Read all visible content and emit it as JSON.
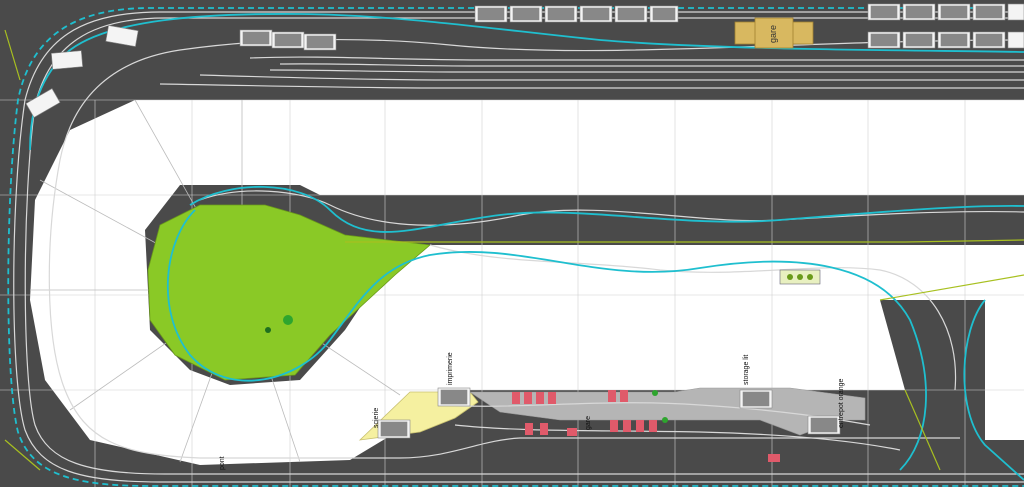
{
  "labels": {
    "gare": "gare",
    "imprimerie": "imprimerie",
    "scierie": "scierie",
    "storage": "storage lit",
    "entrepot": "entrepot orange",
    "pont": "pont",
    "gare_small": "gare"
  },
  "colors": {
    "board": "#4a4a4a",
    "cyan_track": "#1fbfcf",
    "white_track": "#d8d8d8",
    "green_area": "#8ac926",
    "yellow_area": "#f5f0a0",
    "grey_area": "#b5b5b5",
    "red_car": "#e05a6a",
    "gare_building": "#d8b860"
  }
}
